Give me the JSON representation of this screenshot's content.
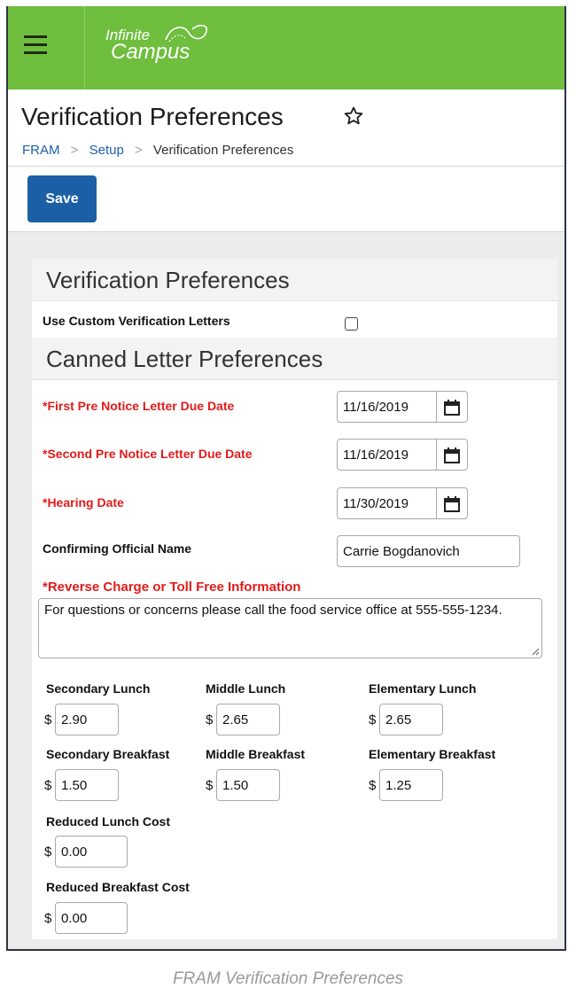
{
  "app": {
    "logo_line1": "Infinite",
    "logo_line2": "Campus",
    "brand_color": "#6fbe3e"
  },
  "header": {
    "title": "Verification Preferences",
    "breadcrumbs": [
      "FRAM",
      "Setup",
      "Verification Preferences"
    ],
    "separator": ">"
  },
  "toolbar": {
    "save_label": "Save"
  },
  "section1": {
    "title": "Verification Preferences",
    "custom_letters_label": "Use Custom Verification Letters",
    "custom_letters_checked": false
  },
  "section2": {
    "title": "Canned Letter Preferences",
    "first_pre_notice": {
      "label": "*First Pre Notice Letter Due Date",
      "value": "11/16/2019"
    },
    "second_pre_notice": {
      "label": "*Second Pre Notice Letter Due Date",
      "value": "11/16/2019"
    },
    "hearing_date": {
      "label": "*Hearing Date",
      "value": "11/30/2019"
    },
    "confirming_official": {
      "label": "Confirming Official Name",
      "value": "Carrie Bogdanovich"
    },
    "reverse_charge": {
      "label": "*Reverse Charge or Toll Free Information",
      "value": "For questions or concerns please call the food service office at 555-555-1234."
    }
  },
  "costs": {
    "currency": "$",
    "secondary_lunch": {
      "label": "Secondary Lunch",
      "value": "2.90"
    },
    "middle_lunch": {
      "label": "Middle Lunch",
      "value": "2.65"
    },
    "elementary_lunch": {
      "label": "Elementary Lunch",
      "value": "2.65"
    },
    "secondary_breakfast": {
      "label": "Secondary Breakfast",
      "value": "1.50"
    },
    "middle_breakfast": {
      "label": "Middle Breakfast",
      "value": "1.50"
    },
    "elementary_breakfast": {
      "label": "Elementary Breakfast",
      "value": "1.25"
    },
    "reduced_lunch": {
      "label": "Reduced Lunch Cost",
      "value": "0.00"
    },
    "reduced_breakfast": {
      "label": "Reduced Breakfast Cost",
      "value": "0.00"
    }
  },
  "caption": "FRAM Verification Preferences",
  "icons": {
    "menu": "hamburger-menu-icon",
    "favorite": "star-outline-icon",
    "date": "calendar-icon",
    "resize": "resize-grip-icon"
  }
}
